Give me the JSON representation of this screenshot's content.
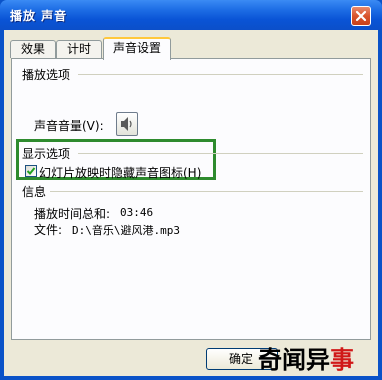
{
  "window": {
    "title": "播放 声音"
  },
  "tabs": [
    {
      "label": "效果"
    },
    {
      "label": "计时"
    },
    {
      "label": "声音设置"
    }
  ],
  "playback_options": {
    "title": "播放选项",
    "volume_label": "声音音量(V):"
  },
  "display_options": {
    "title": "显示选项",
    "hide_icon_label": "幻灯片放映时隐藏声音图标(H)",
    "hide_icon_checked": true
  },
  "info": {
    "title": "信息",
    "duration_label": "播放时间总和:",
    "duration_value": "03:46",
    "file_label": "文件:",
    "file_value": "D:\\音乐\\避风港.mp3"
  },
  "buttons": {
    "ok_label": "确定"
  },
  "watermark": {
    "black_text": "奇闻异",
    "red_text": "事"
  },
  "colors": {
    "titlebar": "#0a54d6",
    "dialog_bg": "#ece9d8",
    "highlight_border": "#2e8b2e",
    "close_button": "#d9542c"
  }
}
